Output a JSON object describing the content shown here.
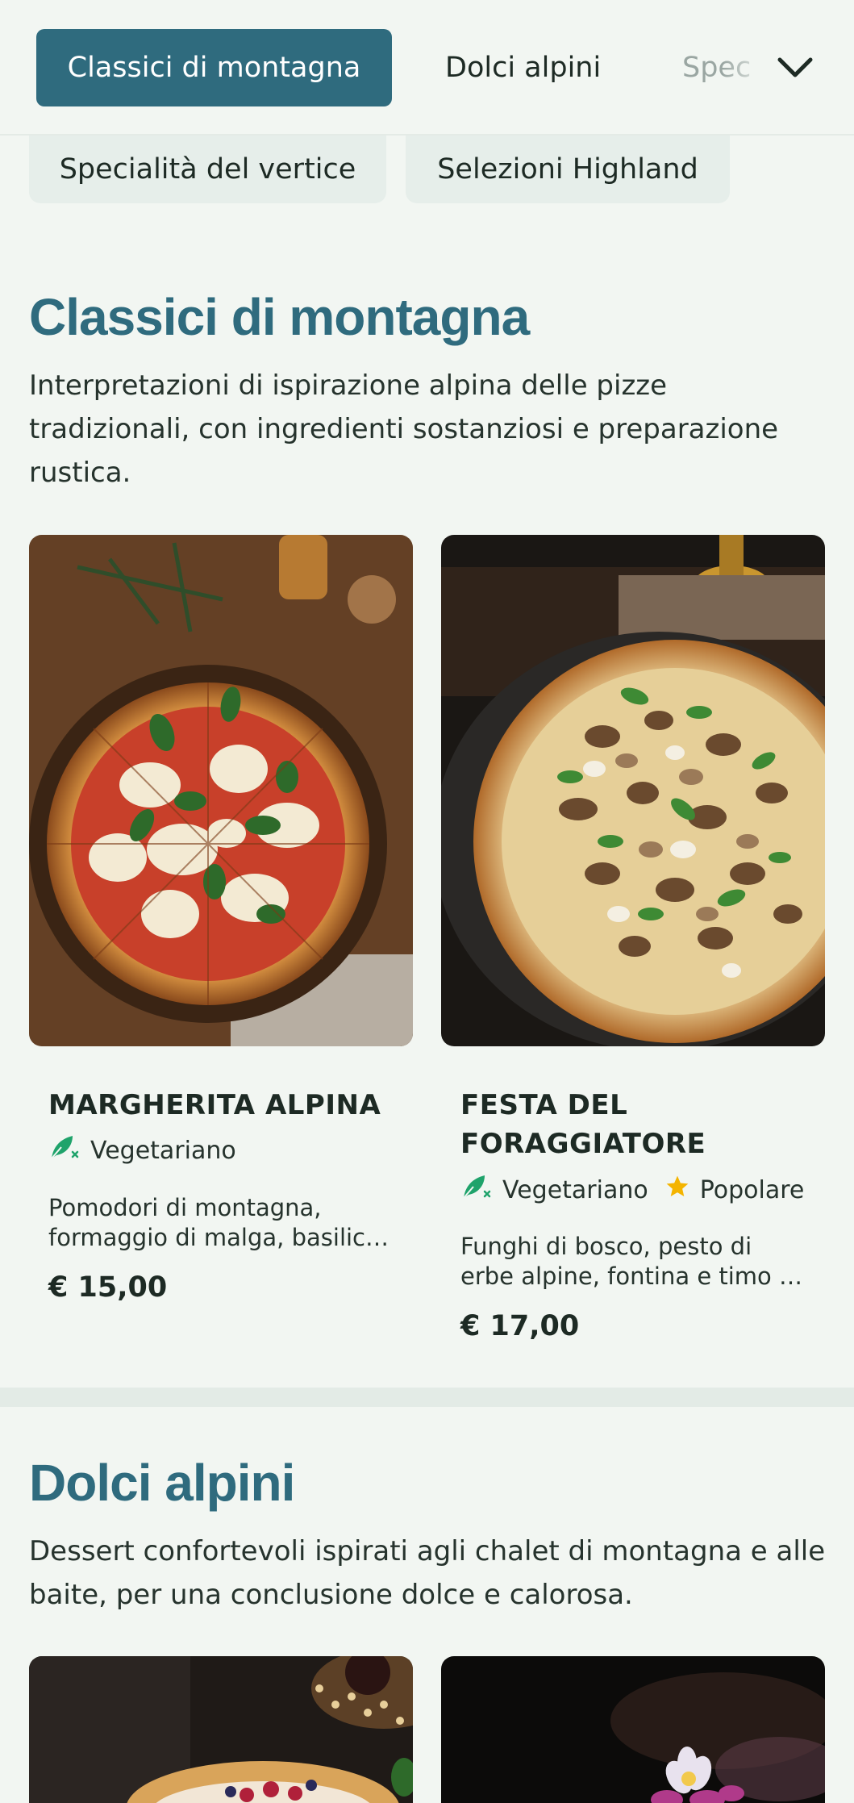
{
  "category_nav": {
    "active": "Classici di montagna",
    "item2": "Dolci alpini",
    "item3_partial": "Spec",
    "secondary": [
      "Specialità del vertice",
      "Selezioni Highland"
    ]
  },
  "sections": [
    {
      "title": "Classici di montagna",
      "description": "Interpretazioni di ispirazione alpina delle pizze tradizionali, con ingredienti sostanziosi e preparazione rustica.",
      "items": [
        {
          "name": "MARGHERITA ALPINA",
          "tags": [
            "Vegetariano"
          ],
          "description": "Pomodori di montagna, formaggio di malga, basilico fresco e olio extravergine",
          "price": "€ 15,00",
          "image": "pizza-margherita-photo"
        },
        {
          "name": "FESTA DEL FORAGGIATORE",
          "tags": [
            "Vegetariano",
            "Popolare"
          ],
          "description": "Funghi di bosco, pesto di erbe alpine, fontina e timo di montagna",
          "price": "€ 17,00",
          "image": "pizza-mushroom-photo"
        }
      ]
    },
    {
      "title": "Dolci alpini",
      "description": "Dessert confortevoli ispirati agli chalet di montagna e alle baite, per una conclusione dolce e calorosa.",
      "items": [
        {
          "image": "dessert-berry-tart-photo"
        },
        {
          "image": "dessert-flowers-photo"
        }
      ]
    }
  ],
  "icons": {
    "vegetarian": "leaf-icon",
    "popular": "star-icon",
    "dropdown": "chevron-down-icon"
  },
  "colors": {
    "accent": "#2f6b7e",
    "background": "#f2f6f2",
    "vegetarian": "#1fa36b",
    "popular": "#f4b400"
  }
}
